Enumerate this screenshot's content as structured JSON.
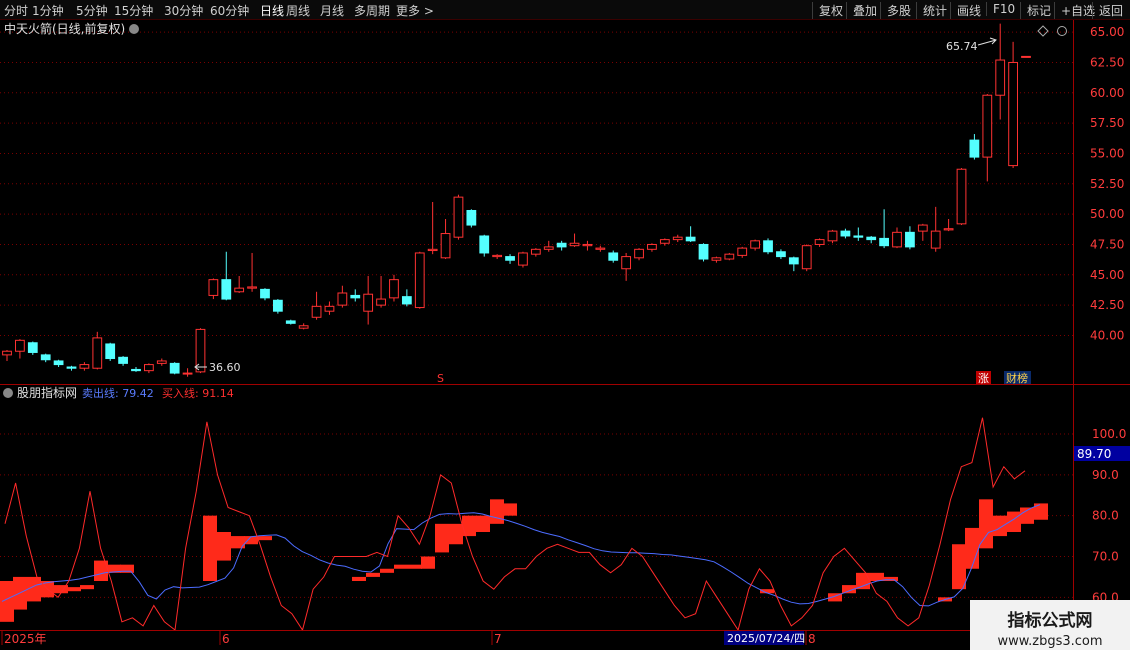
{
  "toolbar": {
    "left": [
      "分时",
      "1分钟",
      "5分钟",
      "15分钟",
      "30分钟",
      "60分钟",
      "日线",
      "周线",
      "月线",
      "多周期",
      "更多 >"
    ],
    "active": "日线",
    "right": [
      "复权",
      "叠加",
      "多股",
      "统计",
      "画线",
      "F10",
      "标记",
      "+自选",
      "返回"
    ]
  },
  "main_panel": {
    "title": "中天火箭(日线,前复权)",
    "high_label": "65.74",
    "low_label": "36.60",
    "marker_s": "S",
    "badges": [
      "涨",
      "财榜"
    ]
  },
  "indicator_panel": {
    "title": "股朋指标网",
    "sell_label": "卖出线: 79.42",
    "buy_label": "买入线: 91.14",
    "current_value": "89.70"
  },
  "x_axis": {
    "labels": [
      "2025年",
      "6",
      "7",
      "8"
    ],
    "cursor_date": "2025/07/24/四"
  },
  "watermark": {
    "line1": "指标公式网",
    "line2": "www.zbgs3.com"
  },
  "colors": {
    "up": "#ff3232",
    "down": "#54ffff",
    "axis_text": "#ff3c3c",
    "grid": "#7a0000",
    "buy_line": "#ff2a2a",
    "sell_line": "#4c6cff",
    "bar_fill": "#ff2a1a",
    "badge_bg": "#c00000",
    "value_box": "#0000a0"
  },
  "chart_data": [
    {
      "type": "candlestick",
      "price_axis": {
        "ticks": [
          40.0,
          42.5,
          45.0,
          47.5,
          50.0,
          52.5,
          55.0,
          57.5,
          60.0,
          62.5,
          65.0
        ],
        "ylim": [
          36.0,
          66.0
        ]
      },
      "candles": [
        [
          38.4,
          38.7,
          37.9,
          38.8
        ],
        [
          38.7,
          39.6,
          38.1,
          39.7
        ],
        [
          39.4,
          38.6,
          38.4,
          39.5
        ],
        [
          38.4,
          38.0,
          37.8,
          38.5
        ],
        [
          37.9,
          37.6,
          37.4,
          38.0
        ],
        [
          37.4,
          37.3,
          37.1,
          37.5
        ],
        [
          37.3,
          37.6,
          37.1,
          37.8
        ],
        [
          37.3,
          39.8,
          37.2,
          40.3
        ],
        [
          39.3,
          38.1,
          37.9,
          39.4
        ],
        [
          38.2,
          37.7,
          37.5,
          38.3
        ],
        [
          37.2,
          37.1,
          37.0,
          37.4
        ],
        [
          37.1,
          37.6,
          36.9,
          37.7
        ],
        [
          37.7,
          37.9,
          37.5,
          38.1
        ],
        [
          37.7,
          36.9,
          36.8,
          37.8
        ],
        [
          36.9,
          36.9,
          36.6,
          37.3
        ],
        [
          37.0,
          40.5,
          36.9,
          40.6
        ],
        [
          43.3,
          44.6,
          43.0,
          44.7
        ],
        [
          44.6,
          43.0,
          42.9,
          46.9
        ],
        [
          43.6,
          43.9,
          43.5,
          44.9
        ],
        [
          43.9,
          44.0,
          43.6,
          46.8
        ],
        [
          43.8,
          43.1,
          42.9,
          43.9
        ],
        [
          42.9,
          42.0,
          41.8,
          43.0
        ],
        [
          41.2,
          41.0,
          40.9,
          41.3
        ],
        [
          40.6,
          40.8,
          40.5,
          41.0
        ],
        [
          41.5,
          42.4,
          41.3,
          43.6
        ],
        [
          42.0,
          42.4,
          41.7,
          42.8
        ],
        [
          42.5,
          43.5,
          42.3,
          44.1
        ],
        [
          43.3,
          43.1,
          42.8,
          43.8
        ],
        [
          42.0,
          43.4,
          40.9,
          44.9
        ],
        [
          42.5,
          43.0,
          42.3,
          44.9
        ],
        [
          43.1,
          44.6,
          42.8,
          45.0
        ],
        [
          43.2,
          42.6,
          42.4,
          43.8
        ],
        [
          42.3,
          46.8,
          42.2,
          46.9
        ],
        [
          47.0,
          47.1,
          46.7,
          51.0
        ],
        [
          46.4,
          48.4,
          46.3,
          49.6
        ],
        [
          48.1,
          51.4,
          47.9,
          51.6
        ],
        [
          50.3,
          49.1,
          48.9,
          50.4
        ],
        [
          48.2,
          46.8,
          46.5,
          48.3
        ],
        [
          46.5,
          46.6,
          46.3,
          46.7
        ],
        [
          46.5,
          46.2,
          45.9,
          46.7
        ],
        [
          45.8,
          46.8,
          45.6,
          46.9
        ],
        [
          46.7,
          47.1,
          46.5,
          47.2
        ],
        [
          47.1,
          47.3,
          46.9,
          47.8
        ],
        [
          47.6,
          47.3,
          47.0,
          47.8
        ],
        [
          47.4,
          47.6,
          47.3,
          48.4
        ],
        [
          47.4,
          47.5,
          47.0,
          47.8
        ],
        [
          47.1,
          47.2,
          46.9,
          47.4
        ],
        [
          46.8,
          46.2,
          46.0,
          47.0
        ],
        [
          45.5,
          46.5,
          44.5,
          46.8
        ],
        [
          46.4,
          47.1,
          46.2,
          47.2
        ],
        [
          47.1,
          47.5,
          46.9,
          47.6
        ],
        [
          47.6,
          47.9,
          47.4,
          48.0
        ],
        [
          47.9,
          48.1,
          47.7,
          48.3
        ],
        [
          48.1,
          47.8,
          47.7,
          49.0
        ],
        [
          47.5,
          46.3,
          46.1,
          47.6
        ],
        [
          46.2,
          46.4,
          46.0,
          46.5
        ],
        [
          46.3,
          46.7,
          46.2,
          46.8
        ],
        [
          46.6,
          47.2,
          46.4,
          47.3
        ],
        [
          47.2,
          47.8,
          47.0,
          47.9
        ],
        [
          47.8,
          46.9,
          46.7,
          48.0
        ],
        [
          46.9,
          46.5,
          46.3,
          47.1
        ],
        [
          46.4,
          45.9,
          45.3,
          46.5
        ],
        [
          45.5,
          47.4,
          45.3,
          47.5
        ],
        [
          47.5,
          47.9,
          47.3,
          48.0
        ],
        [
          47.8,
          48.6,
          47.6,
          48.7
        ],
        [
          48.6,
          48.2,
          48.0,
          48.8
        ],
        [
          48.2,
          48.1,
          47.8,
          48.9
        ],
        [
          48.1,
          47.9,
          47.6,
          48.2
        ],
        [
          48.0,
          47.4,
          47.2,
          50.4
        ],
        [
          47.3,
          48.5,
          47.2,
          48.9
        ],
        [
          48.5,
          47.3,
          47.1,
          49.0
        ],
        [
          48.6,
          49.1,
          47.8,
          49.2
        ],
        [
          47.2,
          48.6,
          46.9,
          50.6
        ],
        [
          48.7,
          48.8,
          48.6,
          49.6
        ],
        [
          49.2,
          53.7,
          49.1,
          53.8
        ],
        [
          56.1,
          54.7,
          54.5,
          56.6
        ],
        [
          54.7,
          59.8,
          52.7,
          59.9
        ],
        [
          59.8,
          62.7,
          57.8,
          65.7
        ],
        [
          54.0,
          62.5,
          53.8,
          64.2
        ],
        [
          63.0,
          63.0,
          63.0,
          63.0
        ]
      ]
    },
    {
      "type": "indicator",
      "y_axis": {
        "ticks": [
          60.0,
          70.0,
          80.0,
          90.0,
          100.0
        ],
        "ylim": [
          52.0,
          112.0
        ]
      },
      "series": [
        {
          "name": "卖出线",
          "values": [
            59,
            60,
            61,
            62,
            63,
            63.5,
            63.8,
            64,
            64.2,
            64.5,
            65,
            65.5,
            66,
            66.2,
            66.4,
            66.4,
            63.8,
            60.5,
            59.6,
            61.8,
            62.6,
            62.3,
            62.4,
            62.5,
            63.1,
            63.9,
            64.7,
            67.2,
            72.5,
            74.8,
            75.1,
            75.2,
            75.3,
            74.5,
            72.6,
            71.2,
            70.3,
            69.2,
            68.4,
            67.9,
            67.6,
            66.9,
            66.4,
            66.2,
            67.7,
            73.1,
            76.8,
            76.7,
            76.6,
            78.2,
            79.4,
            80.3,
            80.5,
            80.4,
            80.6,
            80.7,
            80.4,
            79.8,
            79.3,
            78.8,
            78.1,
            77.4,
            76.6,
            75.9,
            75.4,
            74.9,
            74.1,
            73.4,
            72.7,
            71.9,
            71.4,
            71.1,
            71.0,
            70.9,
            70.9,
            70.8,
            70.7,
            70.5,
            70.4,
            70.1,
            69.8,
            69.5,
            69.2,
            68.7,
            67.5,
            66.2,
            64.8,
            63.4,
            62.3,
            61.2,
            60.5,
            59.6,
            58.8,
            58.4,
            58.5,
            59.0,
            59.6,
            60.2,
            61.0,
            61.8,
            62.5,
            63.3,
            64.0,
            64.3,
            64.3,
            62.6,
            60.0,
            58.0,
            57.9,
            58.8,
            59.5,
            60.1,
            62.2,
            67.1,
            73.0,
            75.9,
            76.6,
            77.9,
            79.2,
            80.7,
            81.9,
            82.7
          ]
        },
        {
          "name": "买入线",
          "values": [
            78,
            88,
            75,
            65,
            62,
            60,
            64,
            72,
            86,
            72,
            64,
            54,
            55,
            53,
            58,
            54,
            52,
            72,
            86,
            103,
            90,
            82,
            81,
            80,
            73,
            65,
            58,
            56,
            52,
            62,
            65,
            70,
            70,
            70,
            70,
            71,
            70,
            80,
            77,
            73,
            80,
            90,
            88,
            78,
            70,
            64,
            62,
            65,
            67,
            67,
            70,
            72,
            73,
            72,
            71,
            71,
            68,
            66,
            68,
            72,
            70,
            66,
            62,
            58,
            55,
            56,
            64,
            60,
            56,
            52,
            62,
            67,
            64,
            58,
            53,
            55,
            58,
            66,
            70,
            72,
            69,
            66,
            61,
            59,
            55,
            53,
            55,
            63,
            73,
            84,
            92,
            93,
            104,
            87,
            92,
            89,
            91
          ]
        }
      ],
      "bars": [
        {
          "top": 64,
          "bottom": 54
        },
        {
          "top": 65,
          "bottom": 57
        },
        {
          "top": 65,
          "bottom": 59
        },
        {
          "top": 64,
          "bottom": 60
        },
        {
          "top": 63,
          "bottom": 61
        },
        {
          "top": 62.5,
          "bottom": 61.5
        },
        {
          "top": 63,
          "bottom": 62
        },
        {
          "top": 69,
          "bottom": 64
        },
        {
          "top": 68,
          "bottom": 66
        },
        {
          "top": 68,
          "bottom": 66
        },
        {
          "top": 80,
          "bottom": 64
        },
        {
          "top": 76,
          "bottom": 69
        },
        {
          "top": 75,
          "bottom": 72
        },
        {
          "top": 75,
          "bottom": 73
        },
        {
          "top": 75,
          "bottom": 74
        },
        {
          "top": 65,
          "bottom": 64
        },
        {
          "top": 66,
          "bottom": 65
        },
        {
          "top": 67,
          "bottom": 66
        },
        {
          "top": 68,
          "bottom": 67
        },
        {
          "top": 68,
          "bottom": 67
        },
        {
          "top": 70,
          "bottom": 67
        },
        {
          "top": 78,
          "bottom": 71
        },
        {
          "top": 78,
          "bottom": 73
        },
        {
          "top": 80,
          "bottom": 75
        },
        {
          "top": 80,
          "bottom": 76
        },
        {
          "top": 84,
          "bottom": 78
        },
        {
          "top": 83,
          "bottom": 80
        },
        {
          "top": 62,
          "bottom": 61
        },
        {
          "top": 61,
          "bottom": 59
        },
        {
          "top": 63,
          "bottom": 61
        },
        {
          "top": 66,
          "bottom": 62
        },
        {
          "top": 66,
          "bottom": 64
        },
        {
          "top": 65,
          "bottom": 64
        },
        {
          "top": 60,
          "bottom": 59
        },
        {
          "top": 73,
          "bottom": 62
        },
        {
          "top": 77,
          "bottom": 67
        },
        {
          "top": 84,
          "bottom": 72
        },
        {
          "top": 80,
          "bottom": 75
        },
        {
          "top": 81,
          "bottom": 76
        },
        {
          "top": 82,
          "bottom": 78
        },
        {
          "top": 83,
          "bottom": 79
        }
      ]
    }
  ]
}
